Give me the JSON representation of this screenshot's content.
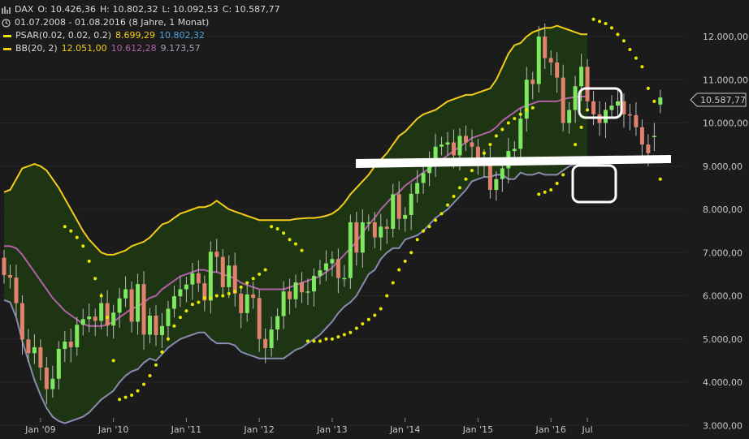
{
  "header": {
    "symbol": "DAX",
    "open": "O: 10.426,36",
    "high": "H: 10.802,32",
    "low": "L: 10.092,53",
    "close": "C: 10.587,77",
    "range": "01.07.2008 - 01.08.2016 (8 Jahre, 1 Monat)",
    "psar_label": "PSAR(0.02, 0.02, 0.2)",
    "psar_value1": "8.699,29",
    "psar_value2": "10.802,32",
    "bb_label": "BB(20, 2)",
    "bb_upper": "12.051,00",
    "bb_mid": "10.612,28",
    "bb_lower": "9.173,57"
  },
  "colors": {
    "background": "#1b1b1b",
    "candle_up": "#7ee860",
    "candle_down": "#e0826e",
    "bb_upper": "#f3cc1a",
    "bb_mid": "#b060a8",
    "bb_lower": "#8a8ab0",
    "bb_fill": "#1e3a12",
    "psar": "#e8e800",
    "psar_value2_color": "#4aa3df",
    "bb_mid_text": "#b060a8",
    "bb_lower_text": "#a0a0c0"
  },
  "chart_data": {
    "type": "candlestick",
    "interval": "monthly",
    "ylim": [
      3000,
      12500
    ],
    "y_ticks": [
      3000,
      4000,
      5000,
      6000,
      7000,
      8000,
      9000,
      10000,
      11000,
      12000
    ],
    "y_tick_labels": [
      "3.000,00",
      "4.000,00",
      "5.000,00",
      "6.000,00",
      "7.000,00",
      "8.000,00",
      "9.000,00",
      "10.000,00",
      "11.000,00",
      "12.000,00"
    ],
    "x_labels": [
      {
        "label": "Jan '09",
        "month_index": 6
      },
      {
        "label": "Jan '10",
        "month_index": 18
      },
      {
        "label": "Jan '11",
        "month_index": 30
      },
      {
        "label": "Jan '12",
        "month_index": 42
      },
      {
        "label": "Jan '13",
        "month_index": 54
      },
      {
        "label": "Jan '14",
        "month_index": 66
      },
      {
        "label": "Jan '15",
        "month_index": 78
      },
      {
        "label": "Jan '16",
        "month_index": 90
      },
      {
        "label": "Jul",
        "month_index": 96
      }
    ],
    "last_price": "10.587,77",
    "close": [
      6480,
      6420,
      5830,
      4990,
      4670,
      4810,
      4340,
      3840,
      4080,
      4770,
      4940,
      4810,
      5330,
      5460,
      5520,
      5420,
      5830,
      5310,
      5610,
      5940,
      6150,
      5400,
      6270,
      5100,
      5540,
      5090,
      5300,
      5700,
      5990,
      6150,
      6260,
      6520,
      6290,
      5890,
      7020,
      6900,
      6200,
      6700,
      6050,
      5600,
      6030,
      5950,
      5000,
      4790,
      5220,
      5530,
      6100,
      5920,
      6310,
      6080,
      6100,
      6460,
      6590,
      6750,
      6850,
      6410,
      6410,
      7700,
      7000,
      7700,
      7700,
      7350,
      7600,
      7550,
      8350,
      7780,
      7870,
      8360,
      8610,
      8840,
      9100,
      9450,
      9500,
      9550,
      9250,
      9700,
      9550,
      9450,
      9100,
      9150,
      8450,
      8700,
      8950,
      9350,
      9400,
      10100,
      11000,
      10900,
      12000,
      11500,
      11400,
      11050,
      10000,
      10300,
      10850,
      11300,
      10500,
      10200,
      10000,
      10300,
      10400,
      10500,
      10200,
      10180,
      9900,
      9500,
      9300,
      9700,
      10588
    ],
    "open": [
      6880,
      6480,
      6420,
      5830,
      4990,
      4670,
      4810,
      4340,
      3840,
      4080,
      4770,
      4940,
      4810,
      5330,
      5460,
      5520,
      5420,
      5830,
      5310,
      5610,
      5940,
      6150,
      5400,
      6270,
      5100,
      5540,
      5090,
      5300,
      5700,
      5990,
      6150,
      6260,
      6520,
      6290,
      5890,
      7020,
      6900,
      6200,
      6700,
      6050,
      5600,
      6030,
      5950,
      5000,
      4790,
      5220,
      5530,
      6100,
      5920,
      6310,
      6080,
      6100,
      6460,
      6590,
      6750,
      6850,
      6410,
      6410,
      7700,
      7000,
      7700,
      7700,
      7350,
      7600,
      7550,
      8350,
      7780,
      7870,
      8360,
      8610,
      8840,
      9100,
      9450,
      9500,
      9550,
      9250,
      9700,
      9550,
      9450,
      9100,
      9150,
      8450,
      8700,
      8950,
      9350,
      9400,
      10100,
      11000,
      10900,
      12000,
      11500,
      11400,
      11050,
      10000,
      10300,
      10850,
      11300,
      10500,
      10200,
      10000,
      10300,
      10400,
      10500,
      10200,
      10180,
      9900,
      9500,
      9700,
      10426
    ],
    "bb_upper": [
      8400,
      8450,
      8700,
      8950,
      9000,
      9050,
      9000,
      8900,
      8700,
      8500,
      8250,
      8000,
      7750,
      7500,
      7300,
      7150,
      7000,
      6950,
      6950,
      7000,
      7050,
      7150,
      7200,
      7250,
      7350,
      7500,
      7650,
      7700,
      7800,
      7900,
      7950,
      8000,
      8050,
      8050,
      8100,
      8200,
      8100,
      8000,
      7950,
      7900,
      7850,
      7800,
      7750,
      7750,
      7750,
      7750,
      7750,
      7750,
      7780,
      7790,
      7800,
      7800,
      7820,
      7850,
      7900,
      8000,
      8150,
      8350,
      8500,
      8650,
      8800,
      9000,
      9150,
      9300,
      9500,
      9700,
      9800,
      9950,
      10100,
      10200,
      10250,
      10300,
      10400,
      10500,
      10550,
      10600,
      10650,
      10650,
      10700,
      10750,
      10800,
      11000,
      11300,
      11600,
      11800,
      11850,
      12000,
      12100,
      12150,
      12200,
      12200,
      12250,
      12200,
      12150,
      12100,
      12050,
      12051
    ],
    "bb_mid": [
      7150,
      7150,
      7100,
      6950,
      6750,
      6550,
      6350,
      6150,
      5950,
      5800,
      5650,
      5550,
      5450,
      5350,
      5300,
      5300,
      5300,
      5330,
      5400,
      5500,
      5600,
      5700,
      5750,
      5850,
      5950,
      6000,
      6150,
      6250,
      6350,
      6450,
      6500,
      6550,
      6600,
      6600,
      6550,
      6550,
      6500,
      6450,
      6400,
      6300,
      6250,
      6200,
      6150,
      6150,
      6150,
      6150,
      6150,
      6200,
      6250,
      6300,
      6350,
      6400,
      6450,
      6550,
      6650,
      6800,
      6950,
      7100,
      7250,
      7450,
      7650,
      7800,
      8000,
      8150,
      8300,
      8400,
      8550,
      8650,
      8750,
      8850,
      8950,
      9050,
      9150,
      9250,
      9350,
      9450,
      9550,
      9650,
      9700,
      9750,
      9800,
      9900,
      10050,
      10150,
      10250,
      10350,
      10400,
      10450,
      10500,
      10500,
      10500,
      10500,
      10550,
      10580,
      10600,
      10610,
      10612
    ],
    "bb_lower": [
      5900,
      5850,
      5500,
      4950,
      4500,
      4050,
      3700,
      3400,
      3200,
      3100,
      3050,
      3100,
      3150,
      3200,
      3300,
      3450,
      3600,
      3700,
      3800,
      4000,
      4150,
      4250,
      4300,
      4450,
      4550,
      4500,
      4650,
      4800,
      4900,
      5000,
      5050,
      5100,
      5150,
      5150,
      5000,
      4900,
      4900,
      4900,
      4850,
      4700,
      4650,
      4600,
      4550,
      4550,
      4550,
      4550,
      4550,
      4650,
      4750,
      4800,
      4900,
      5000,
      5100,
      5250,
      5400,
      5600,
      5750,
      5850,
      6000,
      6250,
      6500,
      6600,
      6850,
      7000,
      7100,
      7100,
      7300,
      7350,
      7400,
      7500,
      7650,
      7800,
      7900,
      8000,
      8150,
      8300,
      8450,
      8650,
      8700,
      8750,
      8750,
      8800,
      8800,
      8700,
      8700,
      8850,
      8800,
      8800,
      8850,
      8800,
      8800,
      8800,
      8900,
      9000,
      9050,
      9100,
      9173
    ],
    "psar": [
      7600,
      7500,
      7350,
      7150,
      6800,
      6400,
      6000,
      5500,
      4500,
      3600,
      3650,
      3700,
      3800,
      3950,
      4150,
      4400,
      4700,
      5000,
      5300,
      5500,
      5650,
      5800,
      5850,
      5950,
      5950,
      6000,
      6000,
      6050,
      6100,
      6200,
      6300,
      6400,
      6500,
      6600,
      7600,
      7550,
      7450,
      7300,
      7200,
      7050,
      4950,
      4950,
      4950,
      5000,
      5000,
      5050,
      5100,
      5150,
      5250,
      5350,
      5450,
      5550,
      5700,
      6000,
      6300,
      6600,
      6800,
      7000,
      7300,
      7500,
      7600,
      7750,
      7900,
      8100,
      8300,
      8500,
      8700,
      8900,
      9100,
      9300,
      9500,
      9700,
      9850,
      10000,
      10100,
      10200,
      10300,
      10350,
      8350,
      8400,
      8450,
      8600,
      8800,
      9100,
      9500,
      9900,
      10300,
      12400,
      12350,
      12300,
      12200,
      12050,
      11900,
      11700,
      11500,
      11300,
      10800,
      10500,
      8700
    ]
  }
}
